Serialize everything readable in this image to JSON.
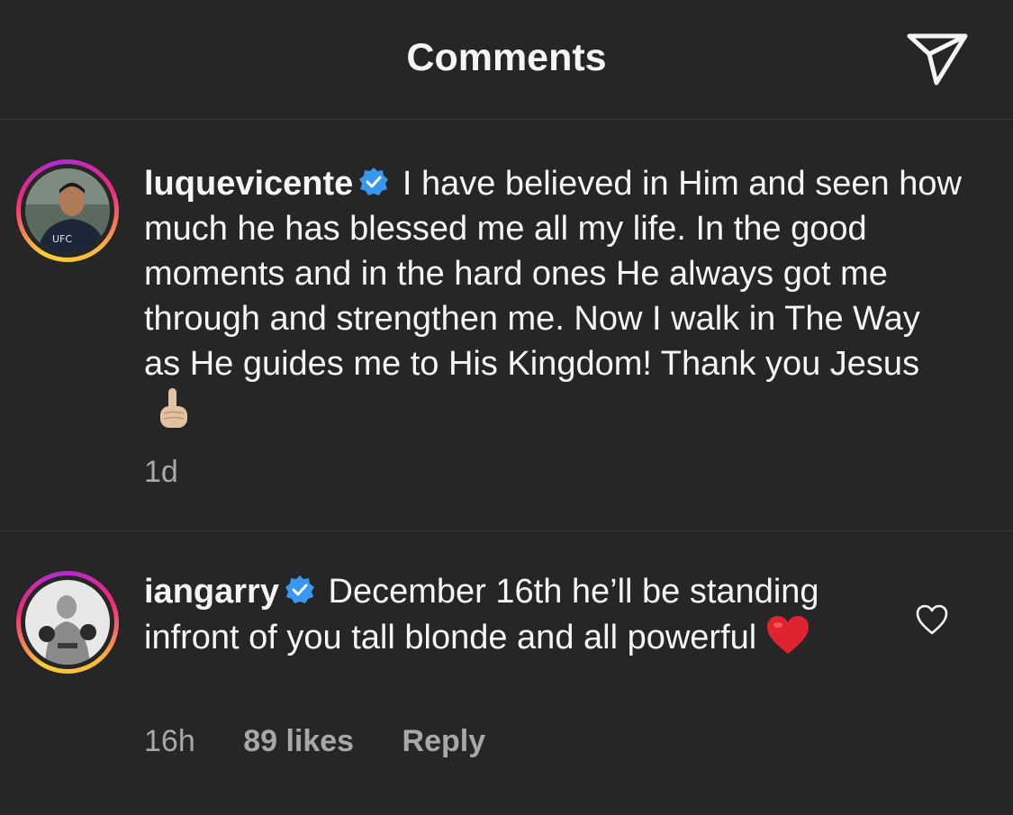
{
  "header": {
    "title": "Comments",
    "share_icon": "send-icon"
  },
  "comments": [
    {
      "username": "luquevicente",
      "verified": true,
      "text": "I have believed in Him and seen how much he has blessed me all my life. In the good moments and in the hard ones He always got me through and strengthen me. Now I walk in The Way as He guides me to His Kingdom! Thank you Jesus",
      "emoji": "pointing-up-emoji",
      "time": "1d"
    },
    {
      "username": "iangarry",
      "verified": true,
      "text": "December 16th he’ll be standing infront of you tall blonde and all powerful",
      "emoji": "red-heart-emoji",
      "time": "16h",
      "likes": "89 likes",
      "reply_label": "Reply",
      "like_icon": "heart-outline-icon"
    }
  ],
  "colors": {
    "background": "#262626",
    "text": "#f5f5f5",
    "muted": "#a8a8a8",
    "verified": "#3897f0",
    "divider": "#3a3a3a"
  }
}
